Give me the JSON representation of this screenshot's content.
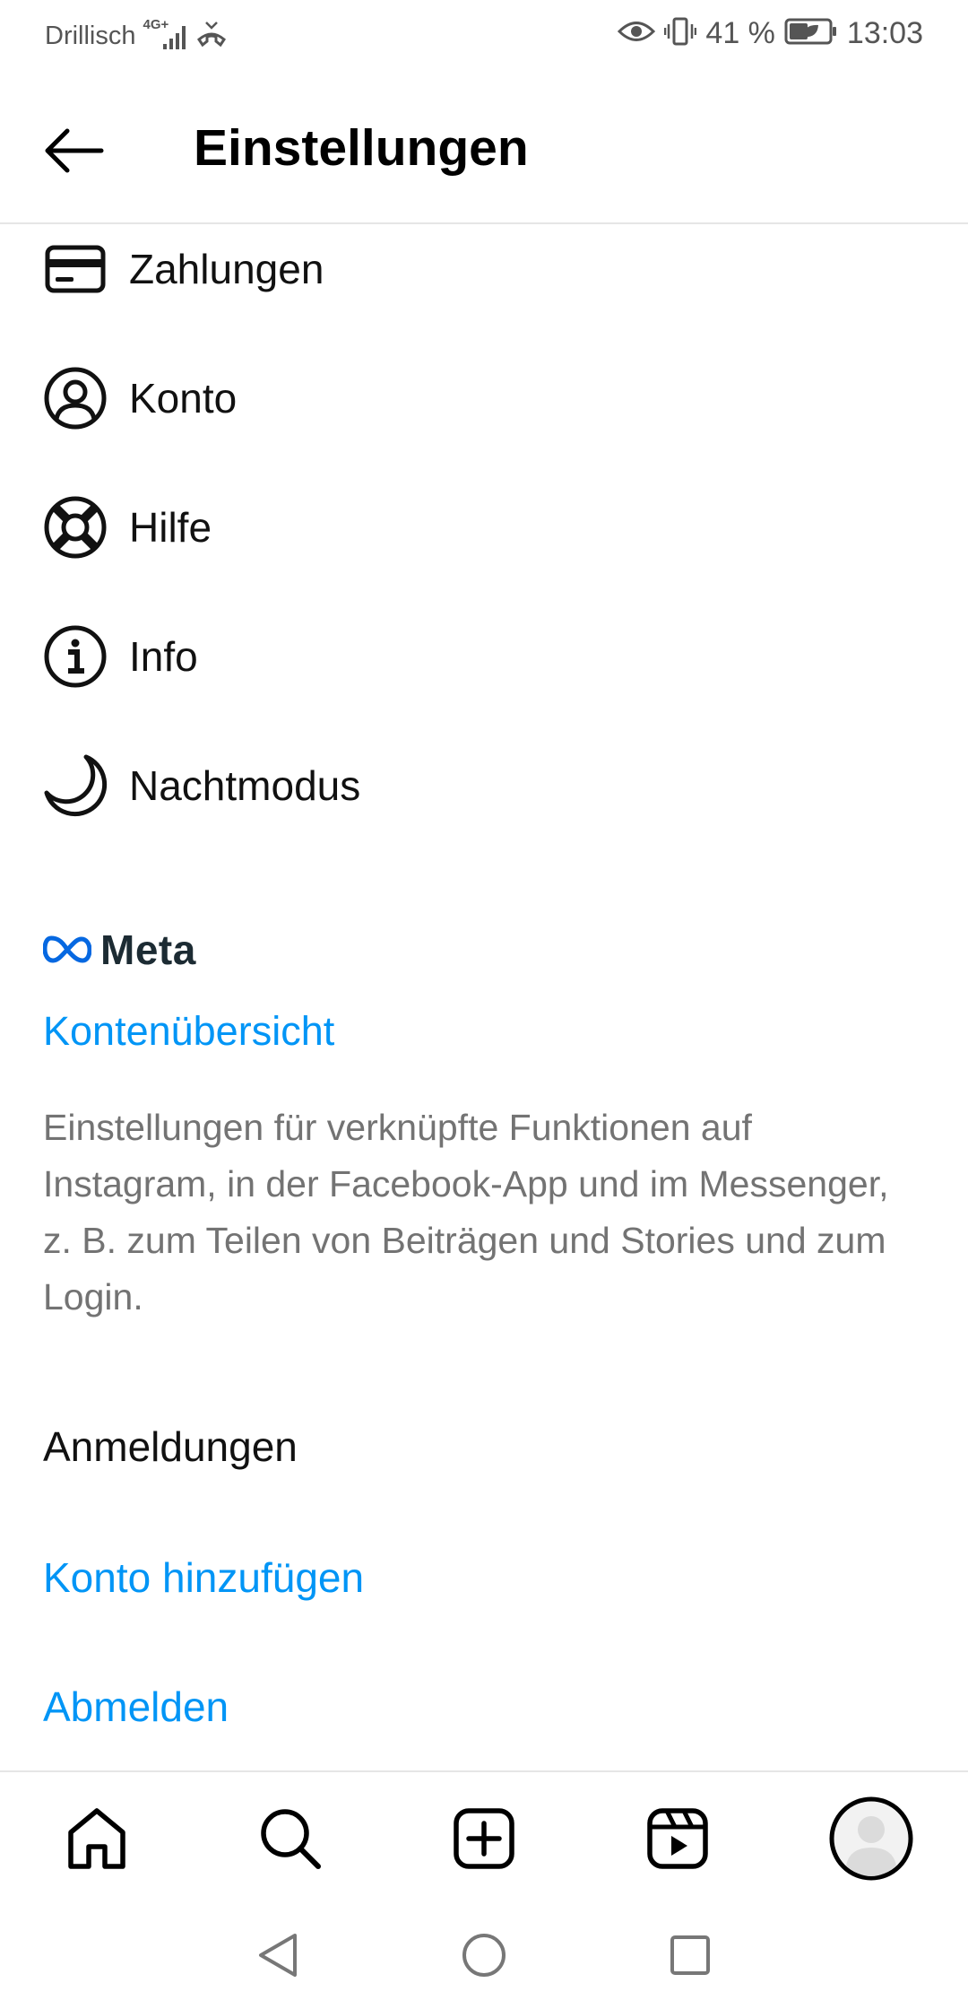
{
  "status_bar": {
    "carrier": "Drillisch",
    "network": "4G+",
    "battery": "41 %",
    "time": "13:03"
  },
  "header": {
    "title": "Einstellungen"
  },
  "menu": {
    "items": [
      {
        "label": "Zahlungen",
        "icon": "card-icon"
      },
      {
        "label": "Konto",
        "icon": "user-circle-icon"
      },
      {
        "label": "Hilfe",
        "icon": "lifebuoy-icon"
      },
      {
        "label": "Info",
        "icon": "info-icon"
      },
      {
        "label": "Nachtmodus",
        "icon": "moon-icon"
      }
    ]
  },
  "meta": {
    "logo_text": "Meta",
    "accounts_center_link": "Kontenübersicht",
    "description": "Einstellungen für verknüpfte Funktionen auf Instagram, in der Facebook-App und im Messenger, z. B. zum Teilen von Beiträgen und Stories und zum Login.",
    "accent_color": "#0095f6",
    "logo_color": "#0668e1"
  },
  "logins": {
    "title": "Anmeldungen",
    "add_account": "Konto hinzufügen",
    "logout": "Abmelden"
  },
  "bottom_nav": {
    "items": [
      "home-icon",
      "search-icon",
      "create-post-icon",
      "reels-icon",
      "profile-avatar"
    ]
  },
  "system_nav": {
    "items": [
      "back-triangle-icon",
      "home-circle-icon",
      "recents-square-icon"
    ]
  }
}
